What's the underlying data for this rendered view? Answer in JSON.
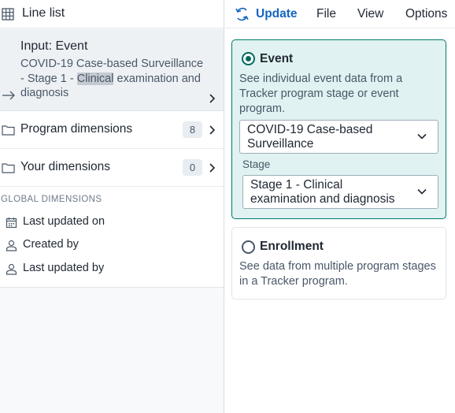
{
  "left_panel": {
    "title": "Line list",
    "input": {
      "heading": "Input: Event",
      "desc_before": "COVID-19 Case-based Surveillance - Stage 1 - ",
      "desc_highlight": "Clinical",
      "desc_after": " examination and diagnosis"
    },
    "dimensions": [
      {
        "label": "Program dimensions",
        "count": "8"
      },
      {
        "label": "Your dimensions",
        "count": "0"
      }
    ],
    "global": {
      "title": "GLOBAL DIMENSIONS",
      "items": [
        {
          "label": "Last updated on",
          "icon": "calendar-icon"
        },
        {
          "label": "Created by",
          "icon": "user-icon"
        },
        {
          "label": "Last updated by",
          "icon": "user-icon"
        }
      ]
    }
  },
  "toolbar": {
    "update_label": "Update",
    "menu": [
      "File",
      "View",
      "Options"
    ]
  },
  "input_types": {
    "event": {
      "title": "Event",
      "selected": true,
      "description": "See individual event data from a Tracker program stage or event program.",
      "program_value": "COVID-19 Case-based Surveillance",
      "stage_label": "Stage",
      "stage_value": "Stage 1 - Clinical examination and diagnosis"
    },
    "enrollment": {
      "title": "Enrollment",
      "selected": false,
      "description": "See data from multiple program stages in a Tracker program."
    }
  },
  "colors": {
    "accent": "#1565c0",
    "selected_card_bg": "#e0f2f1",
    "selected_card_border": "#00796b",
    "highlight": "#c4cad0"
  }
}
